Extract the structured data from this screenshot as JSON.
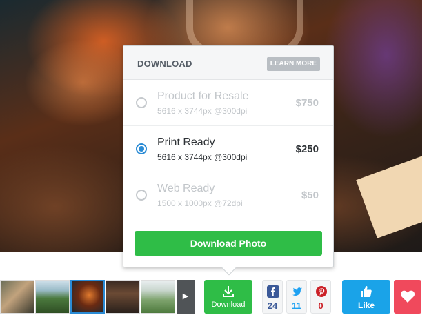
{
  "popup": {
    "title": "DOWNLOAD",
    "learn_more": "LEARN MORE",
    "options": [
      {
        "name": "Product for Resale",
        "spec": "5616 x 3744px @300dpi",
        "price": "$750",
        "selected": false
      },
      {
        "name": "Print Ready",
        "spec": "5616 x 3744px @300dpi",
        "price": "$250",
        "selected": true
      },
      {
        "name": "Web Ready",
        "spec": "1500 x 1000px @72dpi",
        "price": "$50",
        "selected": false
      }
    ],
    "download_button": "Download Photo"
  },
  "toolbar": {
    "thumbnail_next_icon": "chevron-right-icon",
    "download_tile": {
      "label": "Download",
      "icon": "download-icon"
    },
    "social": {
      "facebook": {
        "icon": "facebook-icon",
        "count": "24",
        "color": "#3b5998"
      },
      "twitter": {
        "icon": "twitter-icon",
        "count": "11",
        "color": "#1da1f2"
      },
      "pinterest": {
        "icon": "pinterest-icon",
        "count": "0",
        "color": "#cb2027"
      }
    },
    "like_tile": {
      "label": "Like",
      "icon": "thumbs-up-icon"
    },
    "favorite_tile": {
      "icon": "heart-icon"
    }
  },
  "colors": {
    "accent_green": "#2fbd47",
    "accent_blue": "#1aa3e8",
    "radio_blue": "#2a8bd5",
    "heart_red": "#f0495c"
  }
}
